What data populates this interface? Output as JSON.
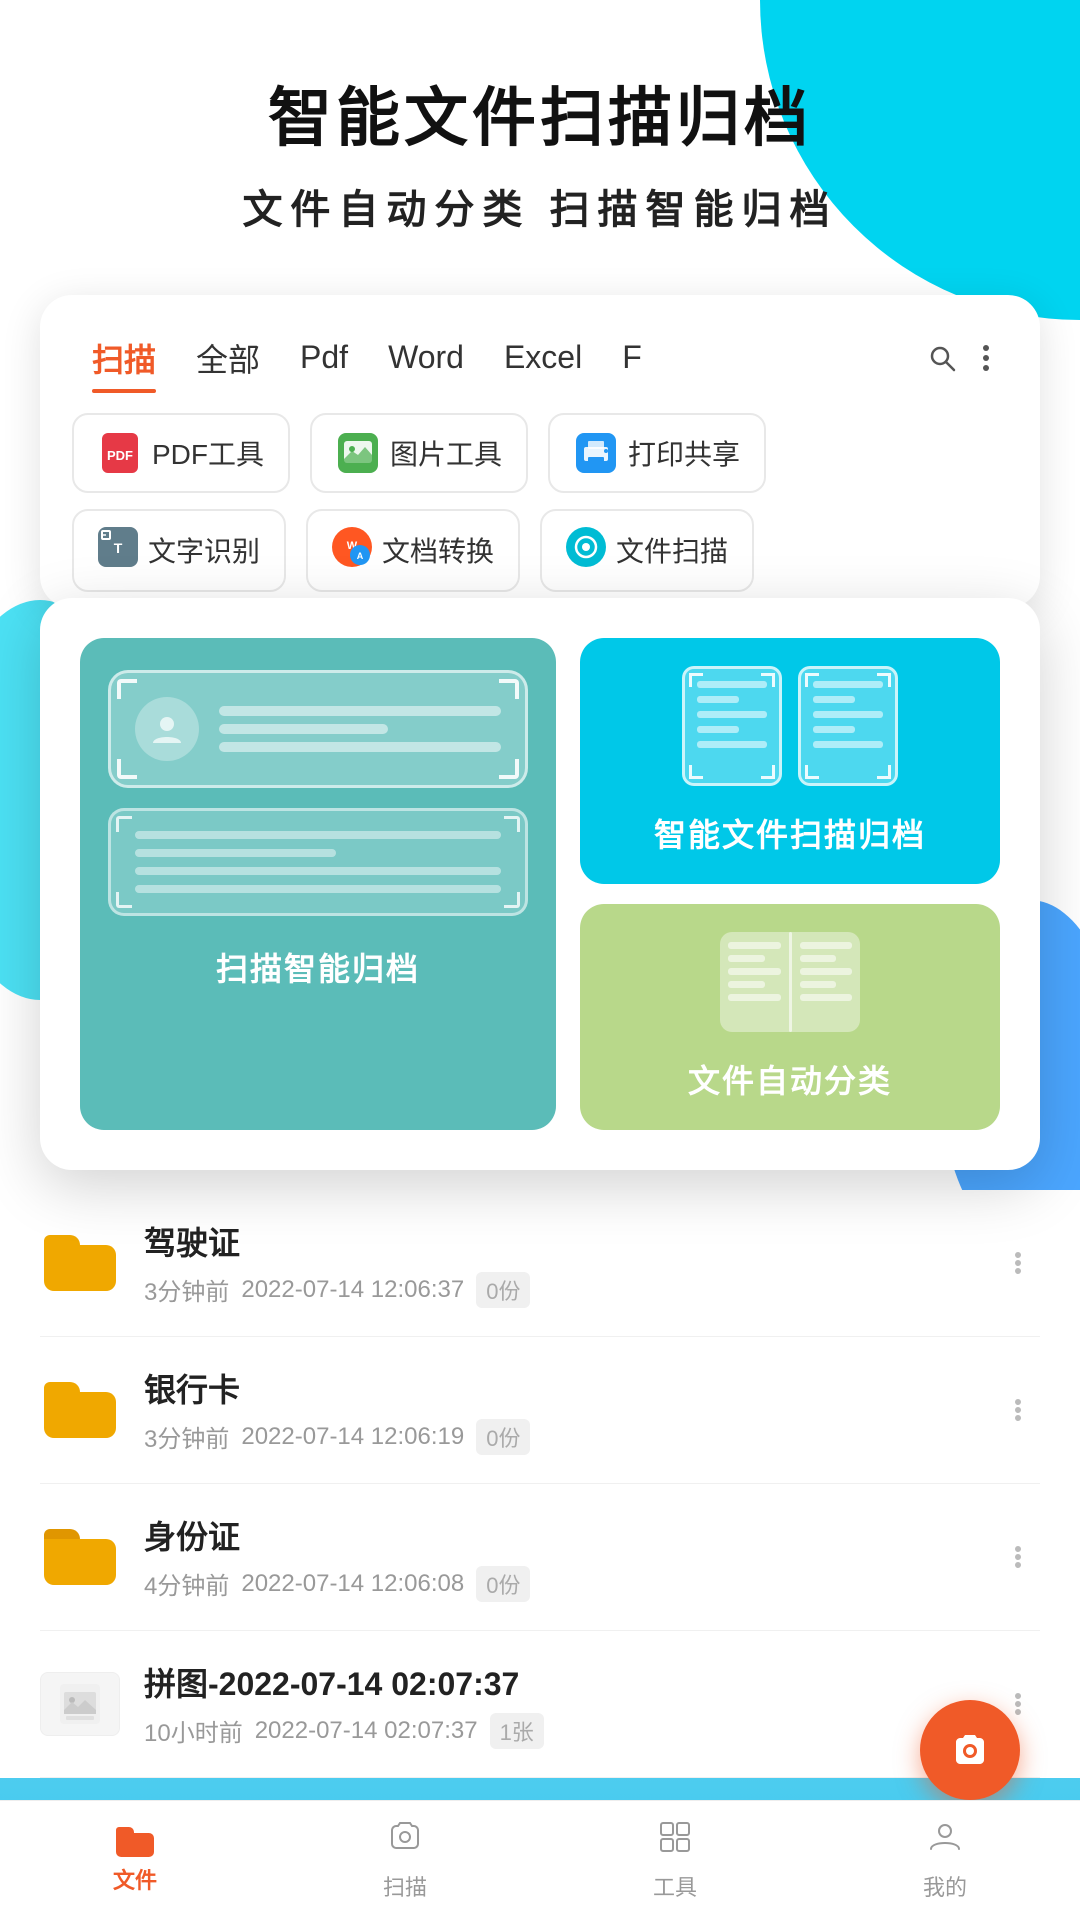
{
  "app": {
    "title": "智能文件扫描归档",
    "subtitle": "文件自动分类   扫描智能归档"
  },
  "tabs": {
    "items": [
      {
        "id": "scan",
        "label": "扫描",
        "active": true
      },
      {
        "id": "all",
        "label": "全部"
      },
      {
        "id": "pdf",
        "label": "Pdf"
      },
      {
        "id": "word",
        "label": "Word"
      },
      {
        "id": "excel",
        "label": "Excel"
      },
      {
        "id": "more",
        "label": "F"
      }
    ]
  },
  "tools_row1": [
    {
      "id": "pdf-tool",
      "label": "PDF工具",
      "icon": "pdf"
    },
    {
      "id": "img-tool",
      "label": "图片工具",
      "icon": "image"
    },
    {
      "id": "print-tool",
      "label": "打印共享",
      "icon": "print"
    }
  ],
  "tools_row2": [
    {
      "id": "ocr-tool",
      "label": "文字识别",
      "icon": "ocr"
    },
    {
      "id": "convert-tool",
      "label": "文档转换",
      "icon": "convert"
    },
    {
      "id": "scan-tool",
      "label": "文件扫描",
      "icon": "scan"
    }
  ],
  "features": {
    "left": {
      "label": "扫描智能归档"
    },
    "right_top": {
      "label": "智能文件扫描归档"
    },
    "right_bottom": {
      "label": "文件自动分类"
    }
  },
  "list_items": [
    {
      "id": "item1",
      "name": "驾驶证",
      "time_ago": "3分钟前",
      "date": "2022-07-14 12:06:37",
      "count": "0份",
      "type": "folder"
    },
    {
      "id": "item2",
      "name": "银行卡",
      "time_ago": "3分钟前",
      "date": "2022-07-14 12:06:19",
      "count": "0份",
      "type": "folder"
    },
    {
      "id": "item3",
      "name": "身份证",
      "time_ago": "4分钟前",
      "date": "2022-07-14 12:06:08",
      "count": "0份",
      "type": "folder"
    },
    {
      "id": "item4",
      "name": "拼图-2022-07-14 02:07:37",
      "time_ago": "10小时前",
      "date": "2022-07-14 02:07:37",
      "count": "1张",
      "type": "image"
    }
  ],
  "bottom_nav": [
    {
      "id": "files",
      "label": "文件",
      "active": true,
      "icon": "folder"
    },
    {
      "id": "scan",
      "label": "扫描",
      "active": false,
      "icon": "camera"
    },
    {
      "id": "tools",
      "label": "工具",
      "active": false,
      "icon": "grid"
    },
    {
      "id": "mine",
      "label": "我的",
      "active": false,
      "icon": "person"
    }
  ]
}
